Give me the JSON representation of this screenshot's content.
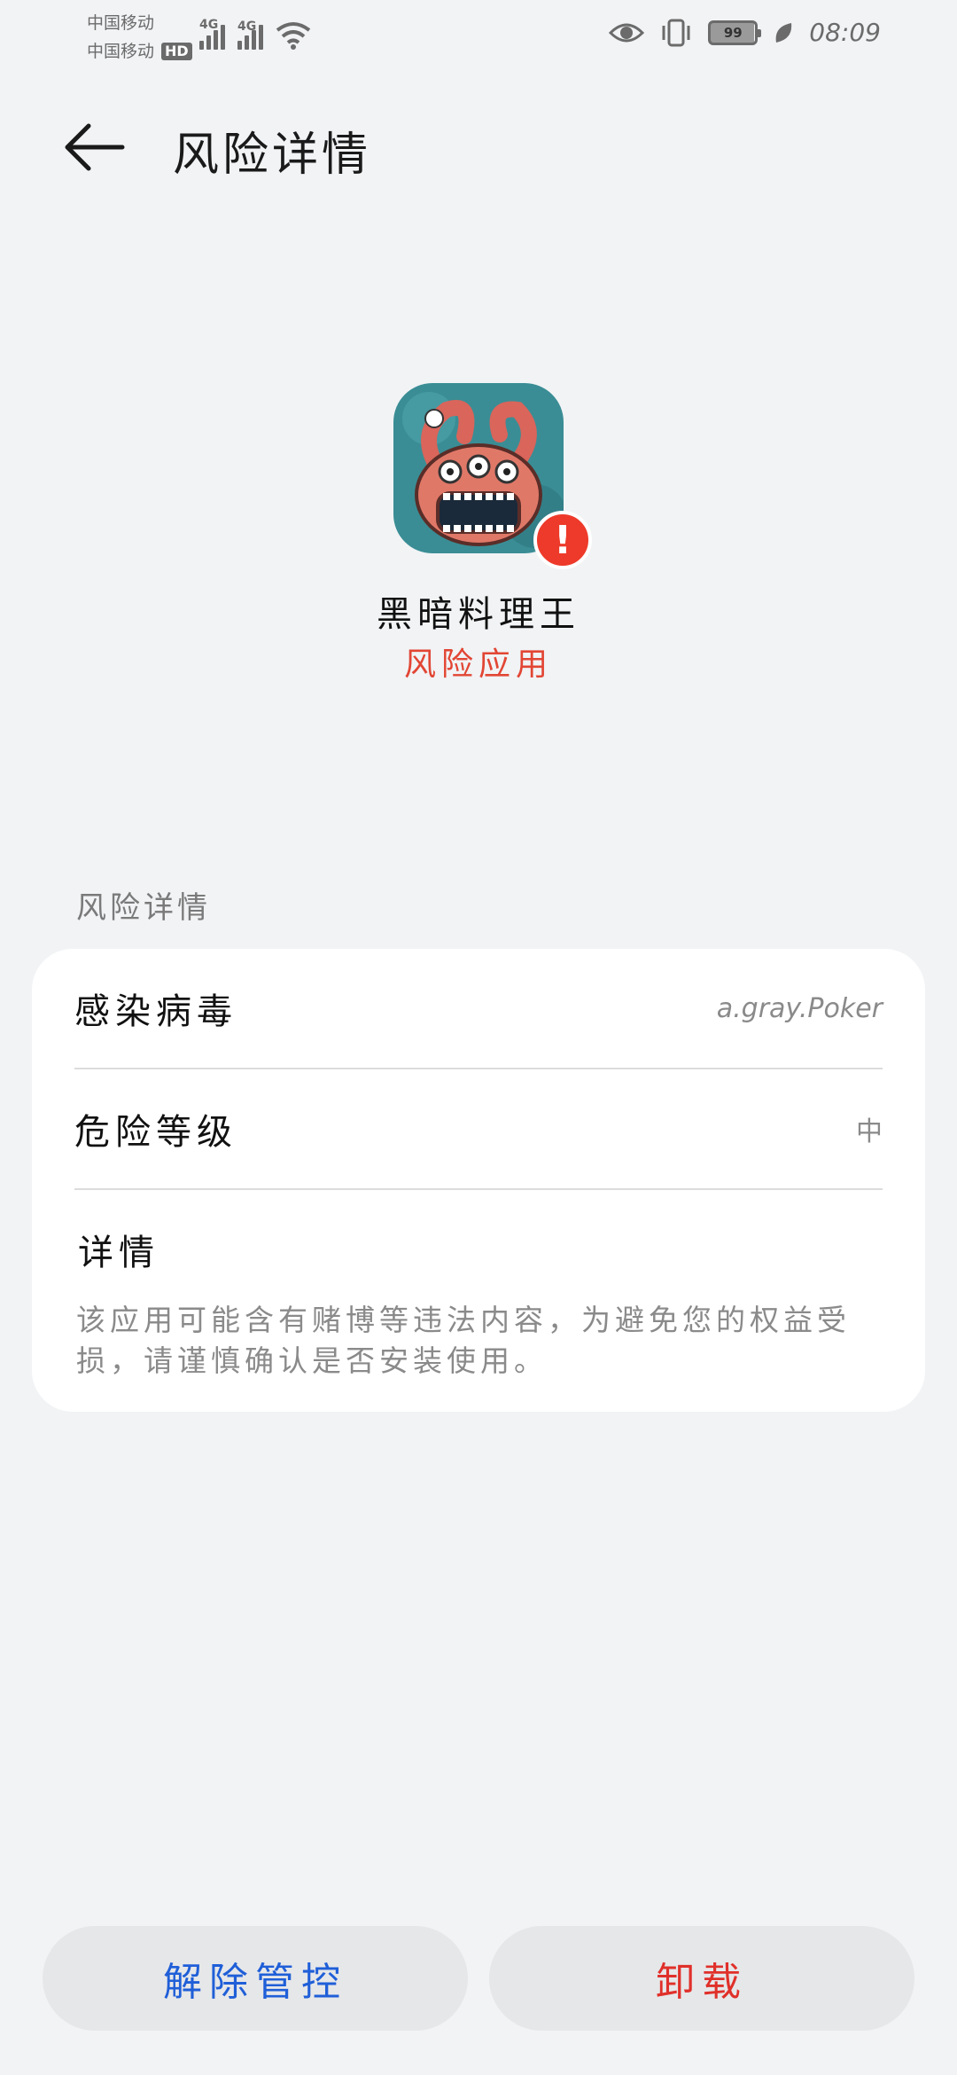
{
  "status_bar": {
    "carrier_1": "中国移动",
    "carrier_2": "中国移动",
    "hd_badge": "HD",
    "network_1": "4G",
    "network_2": "4G",
    "battery_level": "99",
    "time": "08:09"
  },
  "header": {
    "title": "风险详情"
  },
  "app": {
    "name": "黑暗料理王",
    "risk_status": "风险应用",
    "risk_badge_symbol": "!"
  },
  "details_section": {
    "label": "风险详情",
    "virus_label": "感染病毒",
    "virus_value": "a.gray.Poker",
    "level_label": "危险等级",
    "level_value": "中",
    "detail_title": "详情",
    "detail_text": "该应用可能含有赌博等违法内容，为避免您的权益受损，请谨慎确认是否安装使用。"
  },
  "actions": {
    "release_label": "解除管控",
    "uninstall_label": "卸载"
  },
  "colors": {
    "background": "#f1f3f5",
    "risk_red": "#e24634",
    "release_blue": "#1f5fd8",
    "uninstall_red": "#e0302a"
  }
}
